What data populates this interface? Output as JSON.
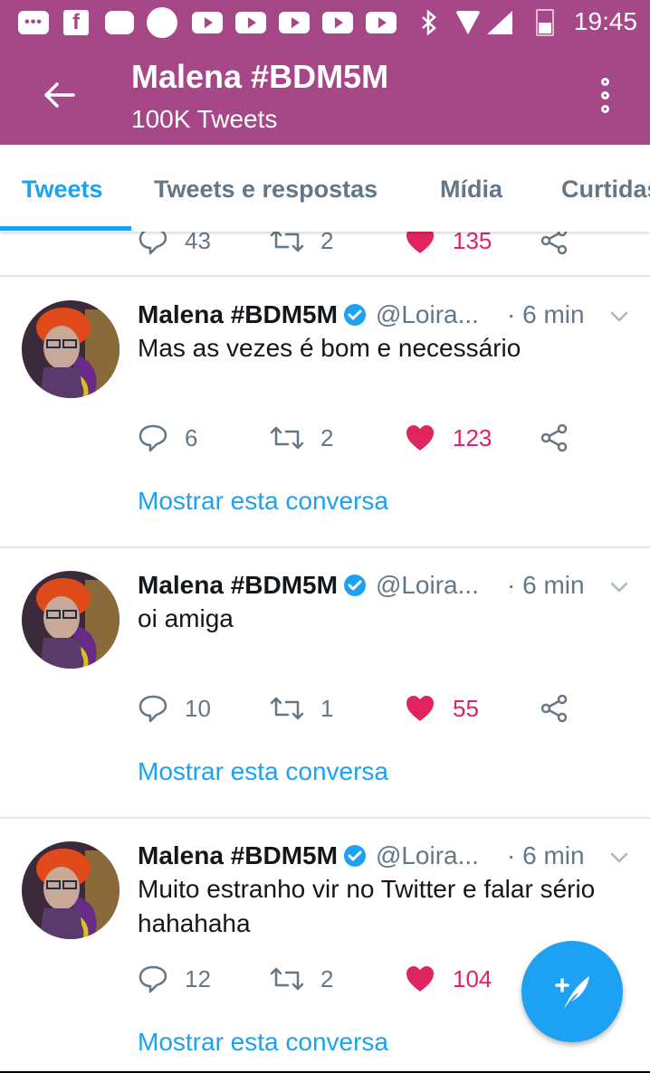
{
  "status_bar": {
    "time": "19:45",
    "icons": [
      "message-icon",
      "facebook-icon",
      "discord-icon",
      "circle-icon",
      "youtube-icon",
      "youtube-icon",
      "youtube-icon",
      "youtube-icon",
      "youtube-icon",
      "bluetooth-icon",
      "wifi-icon",
      "signal-icon",
      "battery-icon"
    ],
    "fb_glyph": "f",
    "msg_glyph": "•••"
  },
  "header": {
    "title": "Malena #BDM5M",
    "subtitle": "100K Tweets",
    "background": "#a64888"
  },
  "tabs": [
    {
      "label": "Tweets",
      "active": true
    },
    {
      "label": "Tweets e respostas",
      "active": false
    },
    {
      "label": "Mídia",
      "active": false
    },
    {
      "label": "Curtidas",
      "active": false
    }
  ],
  "partial_tweet": {
    "replies": "43",
    "retweets": "2",
    "likes": "135"
  },
  "tweets": [
    {
      "name": "Malena #BDM5M",
      "handle": "@Loira...",
      "time": "· 6 min",
      "text": "Mas as vezes é bom e necessário",
      "replies": "6",
      "retweets": "2",
      "likes": "123",
      "show_conversation": "Mostrar esta conversa"
    },
    {
      "name": "Malena #BDM5M",
      "handle": "@Loira...",
      "time": "· 6 min",
      "text": "oi amiga",
      "replies": "10",
      "retweets": "1",
      "likes": "55",
      "show_conversation": "Mostrar esta conversa"
    },
    {
      "name": "Malena #BDM5M",
      "handle": "@Loira...",
      "time": "· 6 min",
      "text": "Muito estranho vir no Twitter e falar sério hahahaha",
      "replies": "12",
      "retweets": "2",
      "likes": "104",
      "show_conversation": "Mostrar esta conversa"
    }
  ],
  "colors": {
    "accent": "#1da1f2",
    "like": "#e0245e",
    "muted": "#657786",
    "text": "#14171a"
  }
}
